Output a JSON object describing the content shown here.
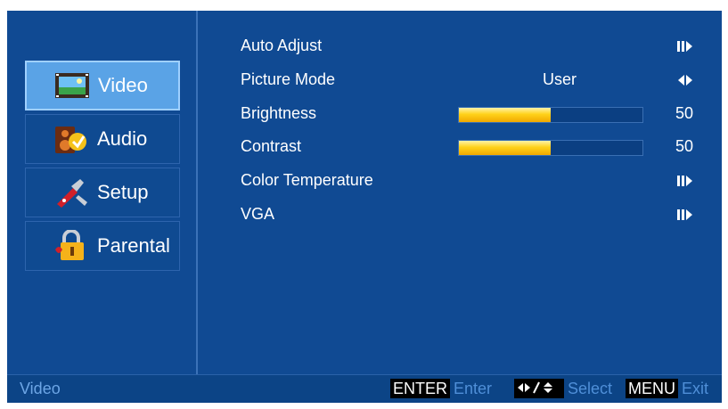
{
  "sidebar": {
    "items": [
      {
        "label": "Video",
        "icon": "video-icon",
        "active": true
      },
      {
        "label": "Audio",
        "icon": "audio-icon",
        "active": false
      },
      {
        "label": "Setup",
        "icon": "setup-icon",
        "active": false
      },
      {
        "label": "Parental",
        "icon": "parental-lock-icon",
        "active": false
      }
    ]
  },
  "menu": {
    "auto_adjust": {
      "label": "Auto Adjust",
      "icon": "submenu-arrow-icon"
    },
    "picture_mode": {
      "label": "Picture Mode",
      "value": "User",
      "icon": "left-right-arrow-icon"
    },
    "brightness": {
      "label": "Brightness",
      "value": "50",
      "level": 50
    },
    "contrast": {
      "label": "Contrast",
      "value": "50",
      "level": 50
    },
    "color_temperature": {
      "label": "Color Temperature",
      "icon": "submenu-arrow-icon"
    },
    "vga": {
      "label": "VGA",
      "icon": "submenu-arrow-icon"
    }
  },
  "footer": {
    "title": "Video",
    "enter_key": "ENTER",
    "enter_text": "Enter",
    "select_key": "◆/◆",
    "select_text": "Select",
    "menu_key": "MENU",
    "menu_text": "Exit"
  },
  "colors": {
    "background": "#104a93",
    "active_item": "#5aa3e6",
    "bar_fill": "#ffd21a",
    "hint_text": "#4f8fd8"
  }
}
